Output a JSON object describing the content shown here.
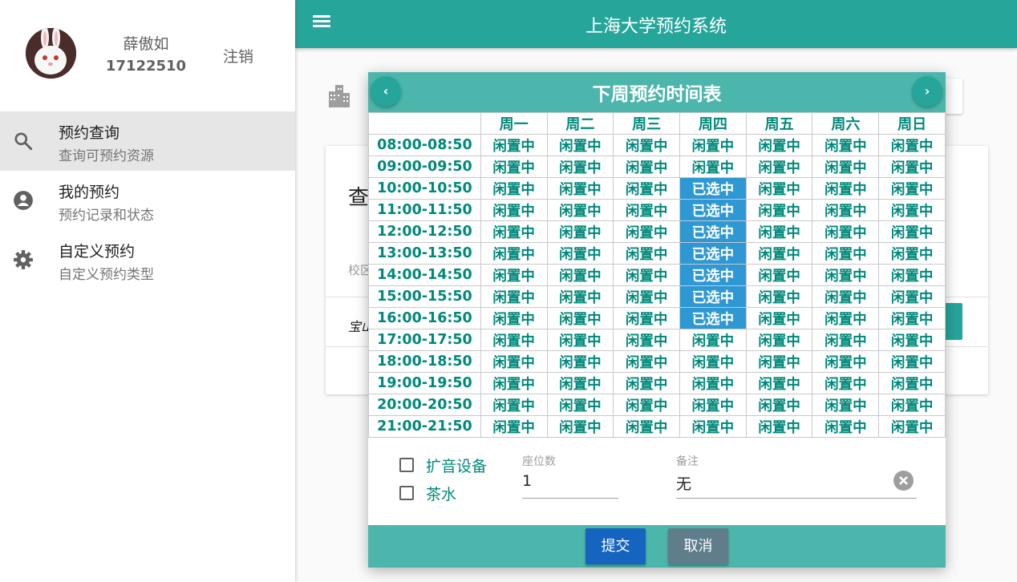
{
  "app": {
    "title": "上海大学预约系统"
  },
  "user": {
    "name": "薛傲如",
    "id": "17122510",
    "logout_label": "注销"
  },
  "sidebar": {
    "items": [
      {
        "title": "预约查询",
        "subtitle": "查询可预约资源",
        "icon": "search-icon",
        "active": true
      },
      {
        "title": "我的预约",
        "subtitle": "预约记录和状态",
        "icon": "account-circle-icon",
        "active": false
      },
      {
        "title": "自定义预约",
        "subtitle": "自定义预约类型",
        "icon": "gear-icon",
        "active": false
      }
    ]
  },
  "background": {
    "query_heading": "查",
    "campus_label": "校区",
    "campus_value": "宝山"
  },
  "dialog": {
    "title": "下周预约时间表",
    "prev_label": "‹",
    "next_label": "›",
    "days": [
      "周一",
      "周二",
      "周三",
      "周四",
      "周五",
      "周六",
      "周日"
    ],
    "slots": [
      "08:00-08:50",
      "09:00-09:50",
      "10:00-10:50",
      "11:00-11:50",
      "12:00-12:50",
      "13:00-13:50",
      "14:00-14:50",
      "15:00-15:50",
      "16:00-16:50",
      "17:00-17:50",
      "18:00-18:50",
      "19:00-19:50",
      "20:00-20:50",
      "21:00-21:50"
    ],
    "status_free": "闲置中",
    "status_selected": "已选中",
    "selected_cells": [
      [
        2,
        3
      ],
      [
        3,
        3
      ],
      [
        4,
        3
      ],
      [
        5,
        3
      ],
      [
        6,
        3
      ],
      [
        7,
        3
      ],
      [
        8,
        3
      ]
    ],
    "options": [
      {
        "label": "扩音设备",
        "checked": false
      },
      {
        "label": "茶水",
        "checked": false
      }
    ],
    "seats": {
      "label": "座位数",
      "value": "1"
    },
    "remarks": {
      "label": "备注",
      "value": "无"
    },
    "submit_label": "提交",
    "cancel_label": "取消"
  },
  "colors": {
    "primary": "#26a69a",
    "header": "#4db6ac",
    "selected": "#2e98d4",
    "text_green": "#00897b",
    "submit": "#1565c0",
    "cancel": "#607d8b"
  }
}
